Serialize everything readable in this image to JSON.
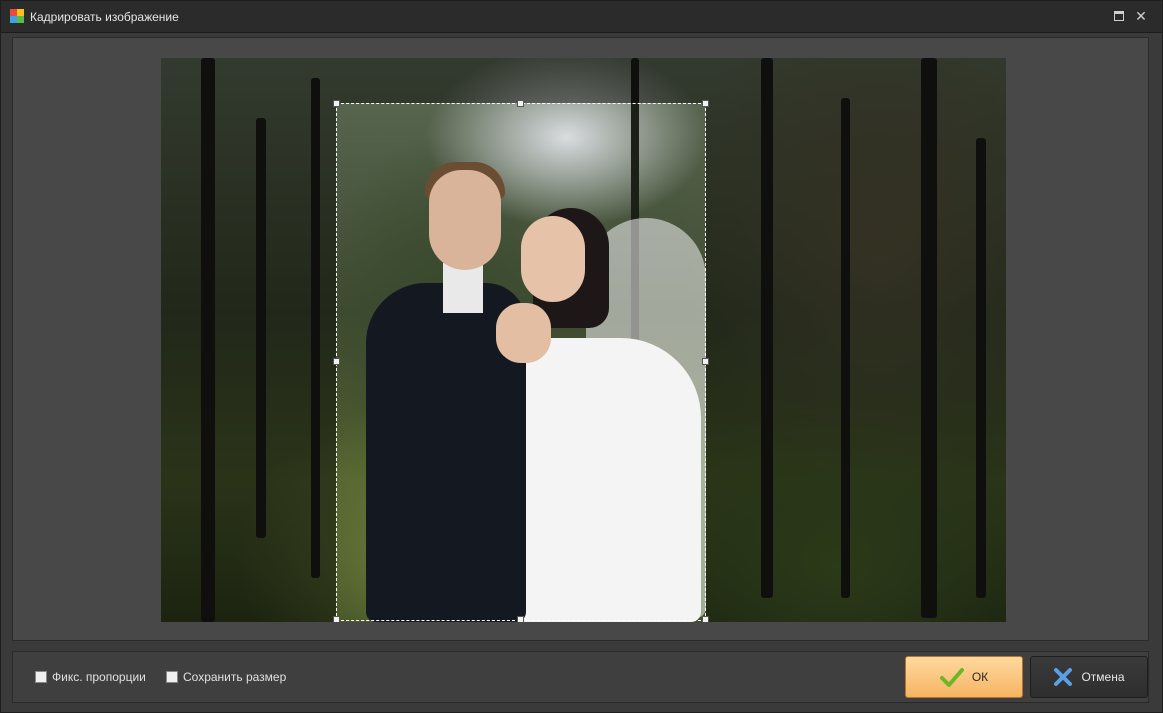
{
  "window": {
    "title": "Кадрировать изображение",
    "maximize_icon": "maximize-icon",
    "close_glyph": "✕"
  },
  "crop": {
    "image": "wedding couple in forest"
  },
  "options": {
    "fix_proportions_label": "Фикс. пропорции",
    "fix_proportions_checked": false,
    "keep_size_label": "Сохранить размер",
    "keep_size_checked": false
  },
  "buttons": {
    "ok_label": "ОК",
    "ok_icon": "checkmark-icon",
    "cancel_label": "Отмена",
    "cancel_icon": "cross-icon"
  },
  "colors": {
    "ok_accent": "#f6b462",
    "cancel_x": "#5aa0e6",
    "check_green": "#6ab82a"
  }
}
